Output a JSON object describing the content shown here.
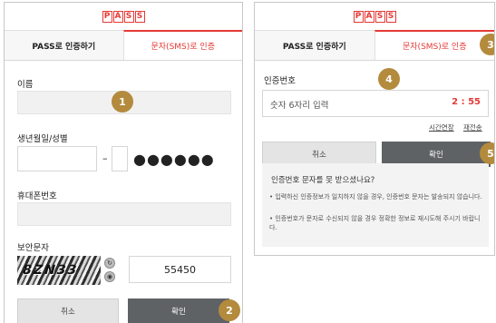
{
  "logo": [
    "P",
    "A",
    "S",
    "S"
  ],
  "colors": {
    "accent": "#e53935",
    "badge": "#b48a3d",
    "ok_button": "#5f6264"
  },
  "left_panel": {
    "tabs": {
      "pass": "PASS로 인증하기",
      "sms": "문자(SMS)로 인증"
    },
    "name_label": "이름",
    "birth_label": "생년월일/성별",
    "gender_dash": "–",
    "masked_digits": "●●●●●●",
    "phone_label": "휴대폰번호",
    "captcha_label": "보안문자",
    "captcha_image_text": "8ZN33",
    "captcha_input_value": "55450",
    "cancel_button": "취소",
    "confirm_button": "확인",
    "badges": {
      "one": "1",
      "two": "2"
    }
  },
  "right_panel": {
    "tabs": {
      "pass": "PASS로 인증하기",
      "sms": "문자(SMS)로 인증"
    },
    "code_label": "인증번호",
    "code_placeholder": "숫자 6자리 입력",
    "timer": "2 : 55",
    "extend_link": "시간연장",
    "resend_link": "재전송",
    "cancel_button": "취소",
    "confirm_button": "확인",
    "help": {
      "title": "인증번호 문자를 못 받으셨나요?",
      "line1": "• 입력하신 인증정보가 일치하지 않을 경우, 인증번호 문자는 발송되지 않습니다.",
      "line2": "• 인증번호가 문자로 수신되지 않을 경우 정확한 정보로 재시도해 주시기 바랍니다."
    },
    "badges": {
      "three": "3",
      "four": "4",
      "five": "5"
    }
  }
}
